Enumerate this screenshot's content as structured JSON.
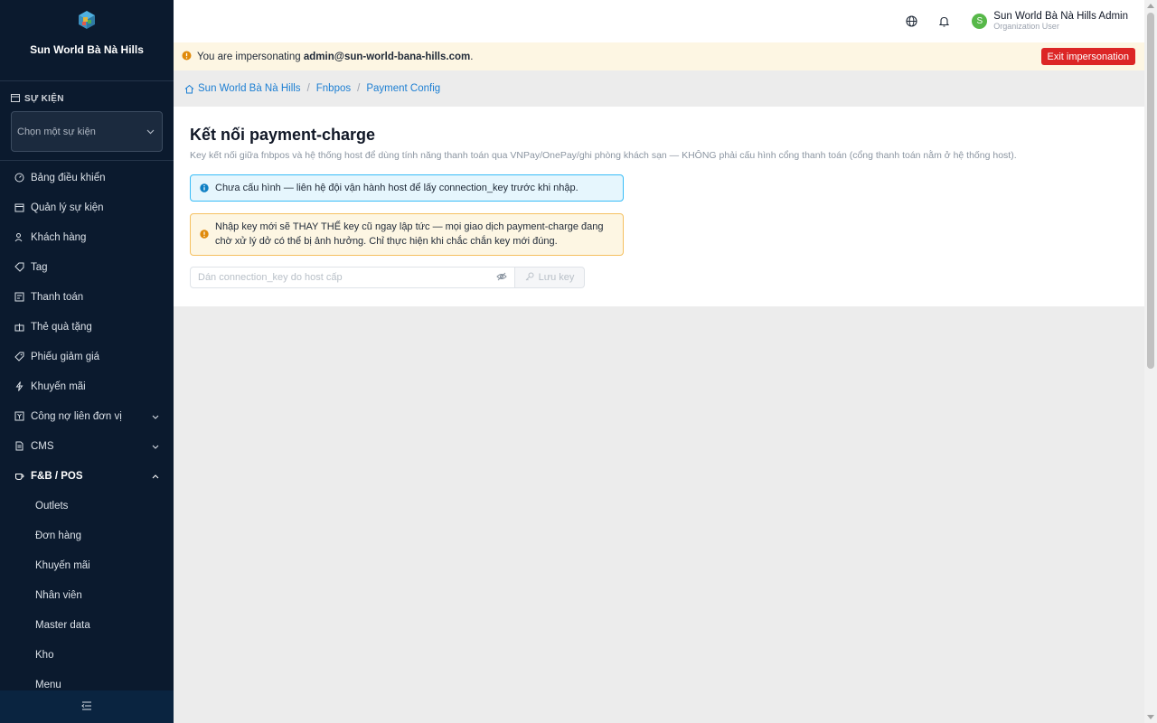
{
  "brand": {
    "name": "Sun World Bà Nà Hills",
    "subtitle": ""
  },
  "event": {
    "section_label": "SỰ KIỆN",
    "placeholder": "Chọn một sự kiện"
  },
  "sidebar": {
    "items": [
      {
        "label": "Bảng điều khiển",
        "icon": "dashboard-icon"
      },
      {
        "label": "Quản lý sự kiện",
        "icon": "calendar-icon"
      },
      {
        "label": "Khách hàng",
        "icon": "users-icon"
      },
      {
        "label": "Tag",
        "icon": "tag-icon"
      },
      {
        "label": "Thanh toán",
        "icon": "payment-icon"
      },
      {
        "label": "Thẻ quà tặng",
        "icon": "gift-icon"
      },
      {
        "label": "Phiếu giảm giá",
        "icon": "coupon-icon"
      },
      {
        "label": "Khuyến mãi",
        "icon": "bolt-icon"
      },
      {
        "label": "Công nợ liên đơn vị",
        "icon": "ledger-icon"
      },
      {
        "label": "CMS",
        "icon": "document-icon"
      },
      {
        "label": "F&B / POS",
        "icon": "coffee-icon"
      }
    ],
    "fnb_subitems": [
      "Outlets",
      "Đơn hàng",
      "Khuyến mãi",
      "Nhân viên",
      "Master data",
      "Kho",
      "Menu"
    ]
  },
  "header": {
    "user_name": "Sun World Bà Nà Hills Admin",
    "user_role": "Organization User",
    "avatar_initial": "S"
  },
  "impersonation": {
    "prefix": "You are impersonating",
    "email": "admin@sun-world-bana-hills.com",
    "suffix": ".",
    "exit_label": "Exit impersonation"
  },
  "breadcrumb": {
    "items": [
      "Sun World Bà Nà Hills",
      "Fnbpos",
      "Payment Config"
    ]
  },
  "card": {
    "title": "Kết nối payment-charge",
    "description": "Key kết nối giữa fnbpos và hệ thống host để dùng tính năng thanh toán qua VNPay/OnePay/ghi phòng khách sạn — KHÔNG phải cấu hình cổng thanh toán (cổng thanh toán nằm ở hệ thống host).",
    "info_alert": "Chưa cấu hình — liên hệ đội vận hành host để lấy connection_key trước khi nhập.",
    "warning_alert": "Nhập key mới sẽ THAY THẾ key cũ ngay lập tức — mọi giao dịch payment-charge đang chờ xử lý dở có thể bị ảnh hưởng. Chỉ thực hiện khi chắc chắn key mới đúng.",
    "key_placeholder": "Dán connection_key do host cấp",
    "save_label": "Lưu key"
  },
  "colors": {
    "sidebar_bg": "#0b1a2e",
    "link": "#1d7fd3",
    "danger": "#dc2626",
    "avatar": "#57b849"
  }
}
